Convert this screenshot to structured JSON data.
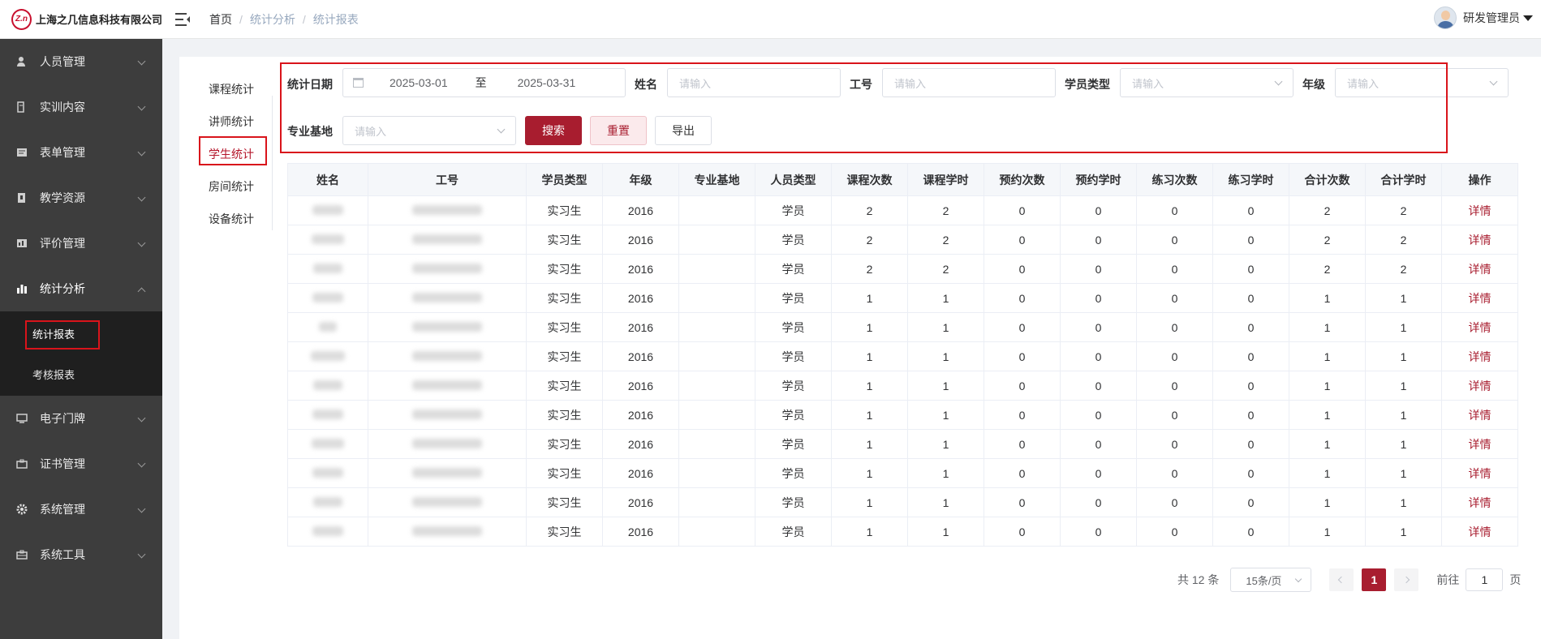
{
  "header": {
    "logo_mark": "Z.n",
    "company": "上海之几信息科技有限公司",
    "breadcrumb": [
      "首页",
      "统计分析",
      "统计报表"
    ],
    "user": "研发管理员"
  },
  "sidebar": {
    "items": [
      {
        "label": "人员管理",
        "icon": "person-icon"
      },
      {
        "label": "实训内容",
        "icon": "book-icon"
      },
      {
        "label": "表单管理",
        "icon": "form-icon"
      },
      {
        "label": "教学资源",
        "icon": "resource-icon"
      },
      {
        "label": "评价管理",
        "icon": "rating-icon"
      },
      {
        "label": "统计分析",
        "icon": "chart-icon"
      },
      {
        "label": "电子门牌",
        "icon": "monitor-icon"
      },
      {
        "label": "证书管理",
        "icon": "certificate-icon"
      },
      {
        "label": "系统管理",
        "icon": "gear-icon"
      },
      {
        "label": "系统工具",
        "icon": "toolbox-icon"
      }
    ],
    "submenu": [
      "统计报表",
      "考核报表"
    ]
  },
  "tabs": [
    "课程统计",
    "讲师统计",
    "学生统计",
    "房间统计",
    "设备统计"
  ],
  "filter": {
    "date_label": "统计日期",
    "date_start": "2025-03-01",
    "date_to": "至",
    "date_end": "2025-03-31",
    "name_label": "姓名",
    "name_placeholder": "请输入",
    "id_label": "工号",
    "id_placeholder": "请输入",
    "type_label": "学员类型",
    "type_placeholder": "请输入",
    "grade_label": "年级",
    "grade_placeholder": "请输入",
    "base_label": "专业基地",
    "base_placeholder": "请输入",
    "search_btn": "搜索",
    "reset_btn": "重置",
    "export_btn": "导出"
  },
  "table": {
    "columns": [
      "姓名",
      "工号",
      "学员类型",
      "年级",
      "专业基地",
      "人员类型",
      "课程次数",
      "课程学时",
      "预约次数",
      "预约学时",
      "练习次数",
      "练习学时",
      "合计次数",
      "合计学时",
      "操作"
    ],
    "rows": [
      [
        "实习生",
        "2016",
        "",
        "学员",
        "2",
        "2",
        "0",
        "0",
        "0",
        "0",
        "2",
        "2",
        "详情"
      ],
      [
        "实习生",
        "2016",
        "",
        "学员",
        "2",
        "2",
        "0",
        "0",
        "0",
        "0",
        "2",
        "2",
        "详情"
      ],
      [
        "实习生",
        "2016",
        "",
        "学员",
        "2",
        "2",
        "0",
        "0",
        "0",
        "0",
        "2",
        "2",
        "详情"
      ],
      [
        "实习生",
        "2016",
        "",
        "学员",
        "1",
        "1",
        "0",
        "0",
        "0",
        "0",
        "1",
        "1",
        "详情"
      ],
      [
        "实习生",
        "2016",
        "",
        "学员",
        "1",
        "1",
        "0",
        "0",
        "0",
        "0",
        "1",
        "1",
        "详情"
      ],
      [
        "实习生",
        "2016",
        "",
        "学员",
        "1",
        "1",
        "0",
        "0",
        "0",
        "0",
        "1",
        "1",
        "详情"
      ],
      [
        "实习生",
        "2016",
        "",
        "学员",
        "1",
        "1",
        "0",
        "0",
        "0",
        "0",
        "1",
        "1",
        "详情"
      ],
      [
        "实习生",
        "2016",
        "",
        "学员",
        "1",
        "1",
        "0",
        "0",
        "0",
        "0",
        "1",
        "1",
        "详情"
      ],
      [
        "实习生",
        "2016",
        "",
        "学员",
        "1",
        "1",
        "0",
        "0",
        "0",
        "0",
        "1",
        "1",
        "详情"
      ],
      [
        "实习生",
        "2016",
        "",
        "学员",
        "1",
        "1",
        "0",
        "0",
        "0",
        "0",
        "1",
        "1",
        "详情"
      ],
      [
        "实习生",
        "2016",
        "",
        "学员",
        "1",
        "1",
        "0",
        "0",
        "0",
        "0",
        "1",
        "1",
        "详情"
      ],
      [
        "实习生",
        "2016",
        "",
        "学员",
        "1",
        "1",
        "0",
        "0",
        "0",
        "0",
        "1",
        "1",
        "详情"
      ]
    ]
  },
  "pagination": {
    "total": "共 12 条",
    "page_size": "15条/页",
    "current": "1",
    "goto_prefix": "前往",
    "goto_value": "1",
    "goto_suffix": "页"
  },
  "colors": {
    "brand": "#a81d2f",
    "highlight_box": "#d9141b",
    "sidebar": "#3d3d3d"
  }
}
